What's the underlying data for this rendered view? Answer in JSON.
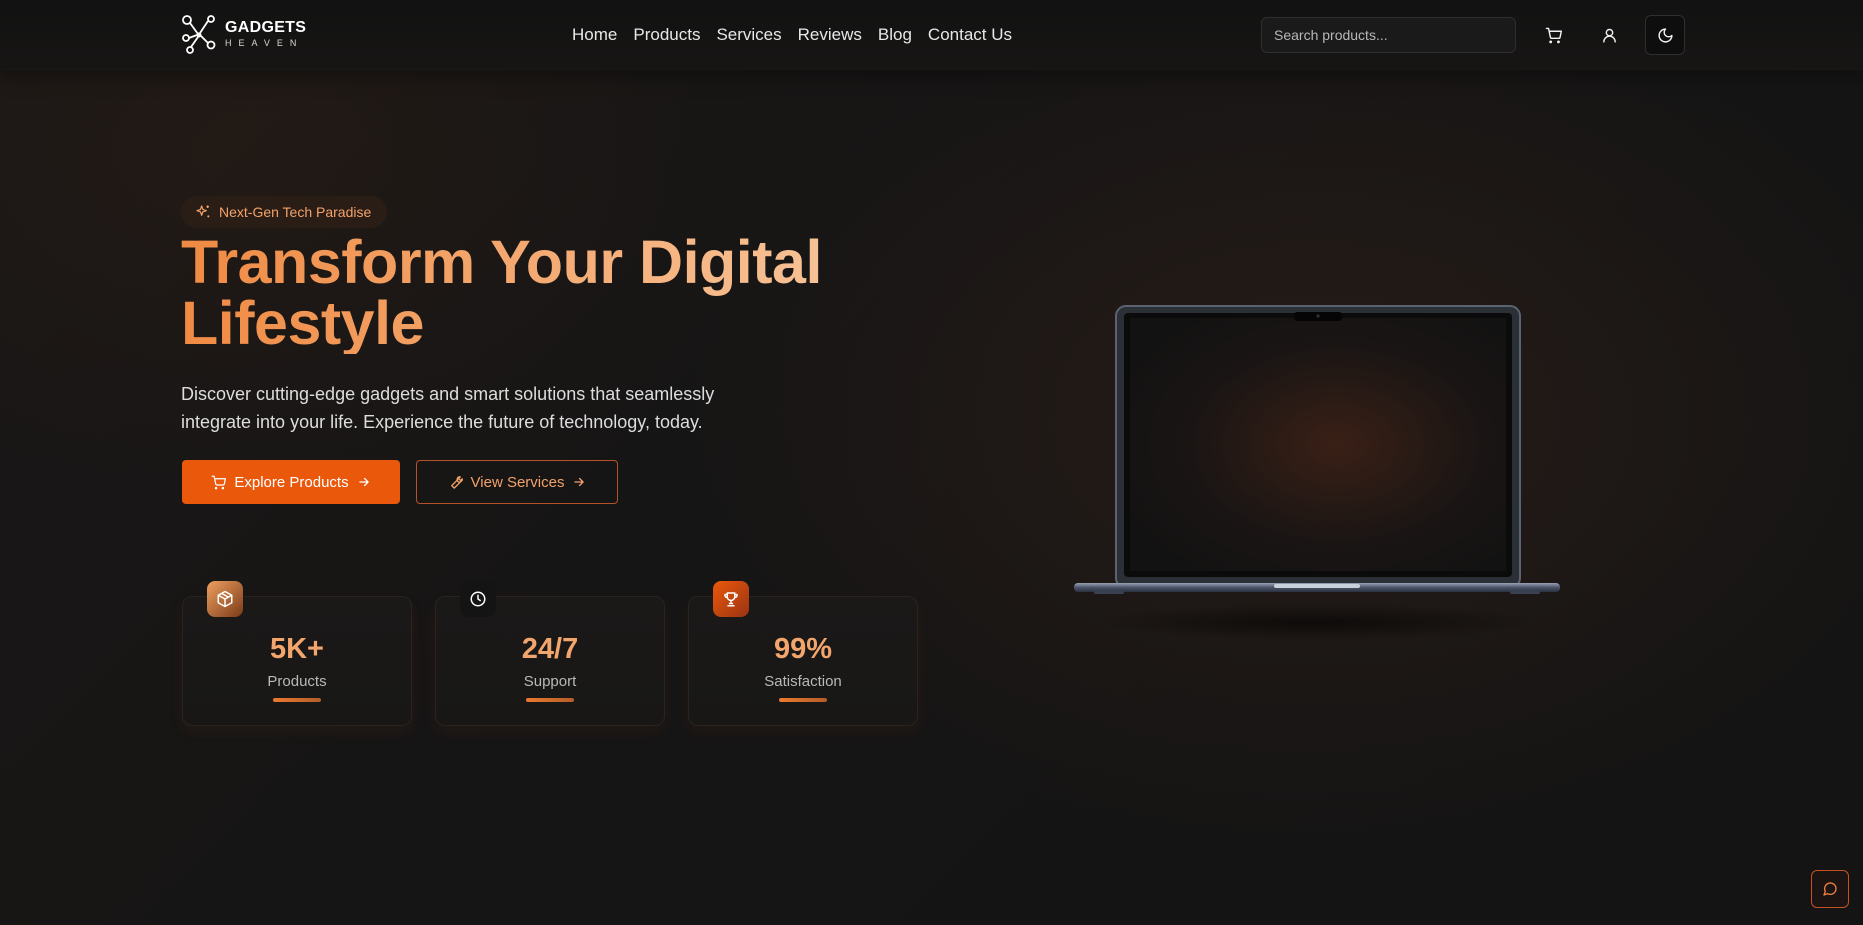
{
  "brand": {
    "line1": "GADGETS",
    "line2": "HEAVEN"
  },
  "nav": {
    "items": [
      {
        "label": "Home"
      },
      {
        "label": "Products"
      },
      {
        "label": "Services"
      },
      {
        "label": "Reviews"
      },
      {
        "label": "Blog"
      },
      {
        "label": "Contact Us"
      }
    ]
  },
  "search": {
    "placeholder": "Search products..."
  },
  "header_icons": [
    "cart-icon",
    "user-icon",
    "moon-icon"
  ],
  "hero": {
    "badge": "Next-Gen Tech Paradise",
    "title": "Transform Your Digital Lifestyle",
    "subtitle": "Discover cutting-edge gadgets and smart solutions that seamlessly integrate into your life. Experience the future of technology, today.",
    "primary_button": "Explore Products",
    "secondary_button": "View Services"
  },
  "stats": [
    {
      "value": "5K+",
      "label": "Products",
      "icon": "package-icon"
    },
    {
      "value": "24/7",
      "label": "Support",
      "icon": "clock-icon"
    },
    {
      "value": "99%",
      "label": "Satisfaction",
      "icon": "trophy-icon"
    }
  ],
  "colors": {
    "accent": "#ea580c",
    "accent_light": "#f3a26a",
    "background": "#161515"
  }
}
